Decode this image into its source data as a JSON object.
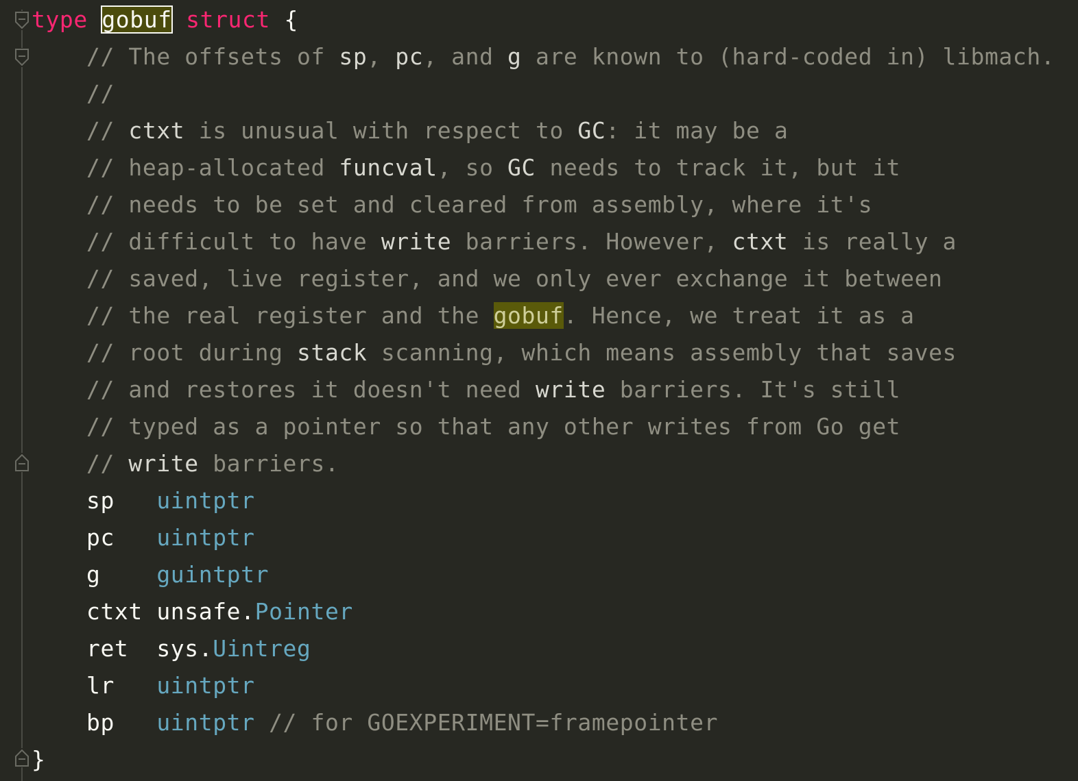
{
  "colors": {
    "background": "#272822",
    "keyword": "#F92672",
    "comment": "#8F8E82",
    "type": "#66A8C0",
    "identifier": "#F8F8F2",
    "highlight": "#5A5A0A"
  },
  "header": {
    "kw_type": "type",
    "name": "gobuf",
    "kw_struct": "struct",
    "open_brace": "{"
  },
  "comment": {
    "l1": [
      "// The offsets of ",
      "sp",
      ", ",
      "pc",
      ", and ",
      "g",
      " are known to (hard-coded in) libmach."
    ],
    "l2": "//",
    "l3": [
      "// ",
      "ctxt",
      " is unusual with respect to ",
      "GC",
      ": it may be a"
    ],
    "l4": [
      "// heap-allocated ",
      "funcval",
      ", so ",
      "GC",
      " needs to track it, but it"
    ],
    "l5": "// needs to be set and cleared from assembly, where it's",
    "l6": [
      "// difficult to have ",
      "write",
      " barriers. However, ",
      "ctxt",
      " is really a"
    ],
    "l7": "// saved, live register, and we only ever exchange it between",
    "l8": [
      "// the real register and the ",
      "gobuf",
      ". Hence, we treat it as a"
    ],
    "l9": [
      "// root during ",
      "stack",
      " scanning, which means assembly that saves"
    ],
    "l10": [
      "// and restores it doesn't need ",
      "write",
      " barriers. It's still"
    ],
    "l11": "// typed as a pointer so that any other writes from Go get",
    "l12": [
      "// ",
      "write",
      " barriers."
    ]
  },
  "fields": [
    {
      "name": "sp  ",
      "pkg": "",
      "type": "uintptr",
      "comment": ""
    },
    {
      "name": "pc  ",
      "pkg": "",
      "type": "uintptr",
      "comment": ""
    },
    {
      "name": "g   ",
      "pkg": "",
      "type": "guintptr",
      "comment": ""
    },
    {
      "name": "ctxt",
      "pkg": "unsafe.",
      "type": "Pointer",
      "comment": ""
    },
    {
      "name": "ret ",
      "pkg": "sys.",
      "type": "Uintreg",
      "comment": ""
    },
    {
      "name": "lr  ",
      "pkg": "",
      "type": "uintptr",
      "comment": ""
    },
    {
      "name": "bp  ",
      "pkg": "",
      "type": "uintptr",
      "comment": " // for GOEXPERIMENT=framepointer"
    }
  ],
  "close_brace": "}"
}
